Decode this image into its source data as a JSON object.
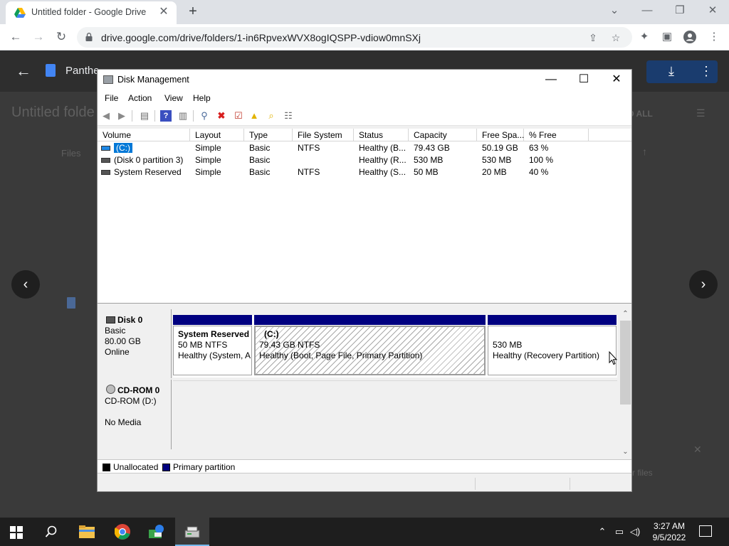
{
  "browser": {
    "tab_title": "Untitled folder - Google Drive",
    "tab_close": "✕",
    "new_tab": "+",
    "url": "drive.google.com/drive/folders/1-in6RpvexWVX8ogIQSPP-vdiow0mnSXj",
    "win_minimize": "—",
    "win_restore": "❐",
    "win_close": "✕"
  },
  "drive": {
    "file_name": "Panthe",
    "folder_title": "Untitled folde",
    "files_label": "Files",
    "view_all": "D ALL",
    "bottom_text": "r files"
  },
  "disk_mgmt": {
    "title": "Disk Management",
    "menu": [
      "File",
      "Action",
      "View",
      "Help"
    ],
    "columns": [
      "Volume",
      "Layout",
      "Type",
      "File System",
      "Status",
      "Capacity",
      "Free Spa...",
      "% Free"
    ],
    "rows": [
      {
        "volume": "(C:)",
        "layout": "Simple",
        "type": "Basic",
        "fs": "NTFS",
        "status": "Healthy (B...",
        "capacity": "79.43 GB",
        "free": "50.19 GB",
        "pct": "63 %"
      },
      {
        "volume": "(Disk 0 partition 3)",
        "layout": "Simple",
        "type": "Basic",
        "fs": "",
        "status": "Healthy (R...",
        "capacity": "530 MB",
        "free": "530 MB",
        "pct": "100 %"
      },
      {
        "volume": "System Reserved",
        "layout": "Simple",
        "type": "Basic",
        "fs": "NTFS",
        "status": "Healthy (S...",
        "capacity": "50 MB",
        "free": "20 MB",
        "pct": "40 %"
      }
    ],
    "disk0": {
      "name": "Disk 0",
      "type": "Basic",
      "size": "80.00 GB",
      "state": "Online",
      "partitions": [
        {
          "name": "System Reserved",
          "size_fs": "50 MB NTFS",
          "status": "Healthy (System, A"
        },
        {
          "name": "(C:)",
          "size_fs": "79.43 GB NTFS",
          "status": "Healthy (Boot, Page File, Primary Partition)"
        },
        {
          "name": "",
          "size_fs": "530 MB",
          "status": "Healthy (Recovery Partition)"
        }
      ]
    },
    "cdrom": {
      "name": "CD-ROM 0",
      "drive": "CD-ROM (D:)",
      "media": "No Media"
    },
    "legend": [
      "Unallocated",
      "Primary partition"
    ],
    "colors": {
      "unallocated": "#000000",
      "primary": "#000080"
    }
  },
  "taskbar": {
    "time": "3:27 AM",
    "date": "9/5/2022"
  }
}
